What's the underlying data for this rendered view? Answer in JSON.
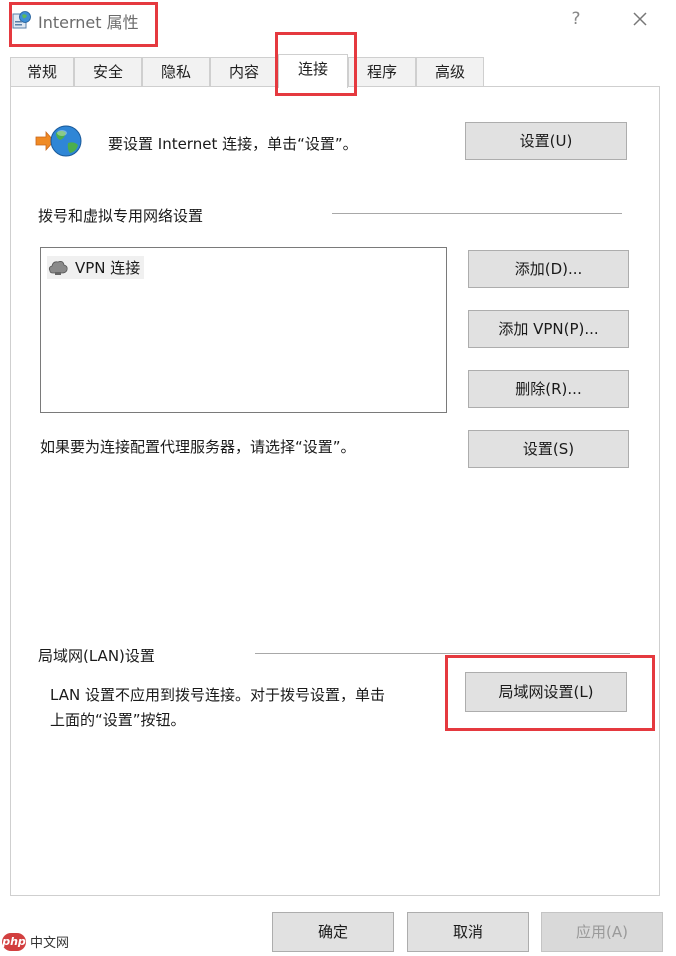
{
  "window": {
    "title": "Internet 属性",
    "help_label": "?",
    "close_label": "✕"
  },
  "tabs": [
    {
      "label": "常规",
      "active": false
    },
    {
      "label": "安全",
      "active": false
    },
    {
      "label": "隐私",
      "active": false
    },
    {
      "label": "内容",
      "active": false
    },
    {
      "label": "连接",
      "active": true
    },
    {
      "label": "程序",
      "active": false
    },
    {
      "label": "高级",
      "active": false
    }
  ],
  "setup": {
    "text": "要设置 Internet 连接，单击“设置”。",
    "button": "设置(U)"
  },
  "dialup": {
    "heading": "拨号和虚拟专用网络设置",
    "list_items": [
      {
        "label": "VPN 连接"
      }
    ],
    "add_button": "添加(D)...",
    "add_vpn_button": "添加 VPN(P)...",
    "delete_button": "删除(R)...",
    "proxy_text": "如果要为连接配置代理服务器，请选择“设置”。",
    "settings_button": "设置(S)"
  },
  "lan": {
    "heading": "局域网(LAN)设置",
    "text_line1": "LAN 设置不应用到拨号连接。对于拨号设置，单击",
    "text_line2": "上面的“设置”按钮。",
    "button": "局域网设置(L)"
  },
  "footer": {
    "ok": "确定",
    "cancel": "取消",
    "apply": "应用(A)"
  },
  "watermark": {
    "logo": "php",
    "text": "中文网"
  },
  "colors": {
    "highlight": "#e5393f",
    "button_bg": "#e1e1e1",
    "tab_bg": "#f2f2f2"
  }
}
